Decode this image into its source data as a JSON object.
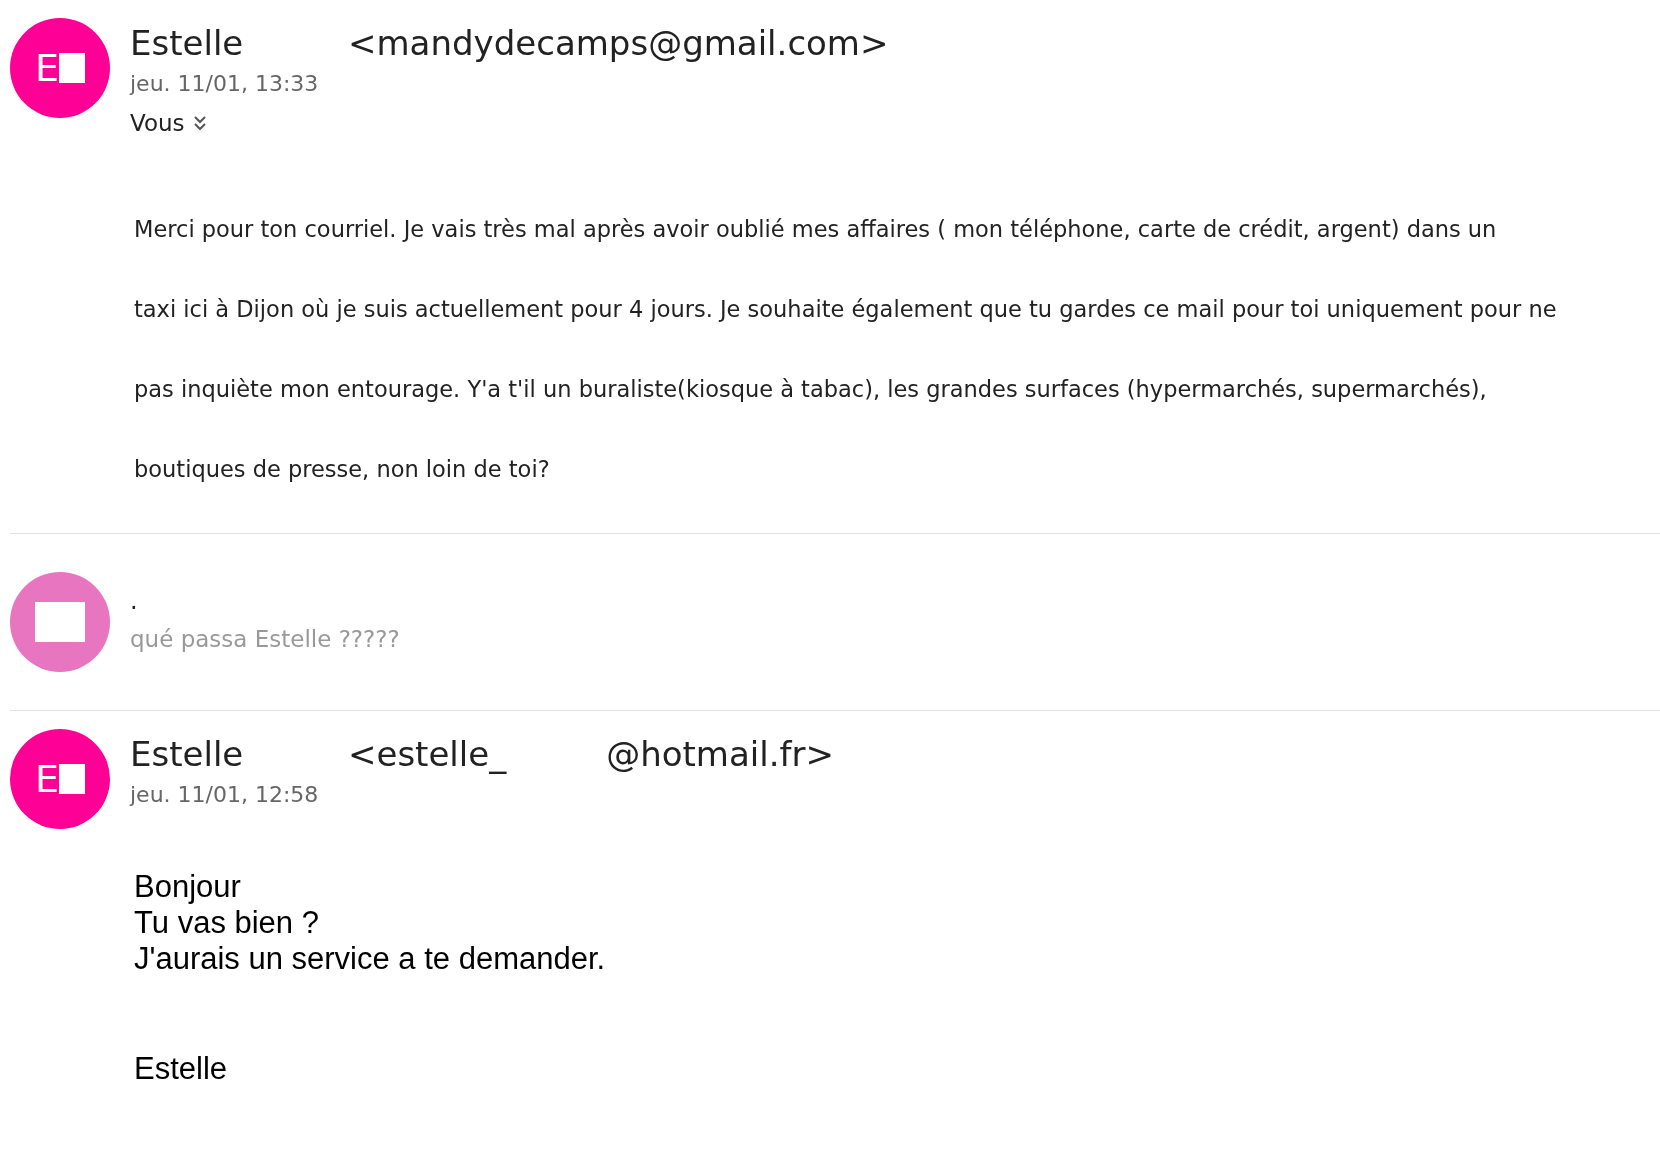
{
  "messages": [
    {
      "kind": "expanded",
      "avatar": {
        "initial": "E",
        "color": "#ff0096"
      },
      "sender": "Estelle",
      "email_parts": [
        "<mandydecamps@gmail.com>"
      ],
      "date": "jeu. 11/01, 13:33",
      "recipients": "Vous",
      "body": [
        "Merci pour ton courriel. Je vais très mal après avoir oublié mes affaires ( mon téléphone, carte de crédit, argent) dans un",
        "taxi ici à Dijon où je suis actuellement pour 4 jours. Je souhaite également que tu gardes ce mail pour toi uniquement pour ne",
        "pas inquiète mon entourage. Y'a t'il un buraliste(kiosque à tabac), les grandes surfaces (hypermarchés, supermarchés),",
        "boutiques de presse, non loin de toi?"
      ]
    },
    {
      "kind": "collapsed",
      "avatar": {
        "color": "#e875bf"
      },
      "sender": ".",
      "preview": "qué passa Estelle ?????"
    },
    {
      "kind": "expanded_plain",
      "avatar": {
        "initial": "E",
        "color": "#ff0096"
      },
      "sender": "Estelle",
      "email_parts": [
        "<estelle_",
        "@hotmail.fr>"
      ],
      "date": "jeu. 11/01, 12:58",
      "body": [
        "Bonjour",
        "Tu vas bien ?",
        "J'aurais un service a te demander."
      ],
      "signature": "Estelle"
    }
  ]
}
